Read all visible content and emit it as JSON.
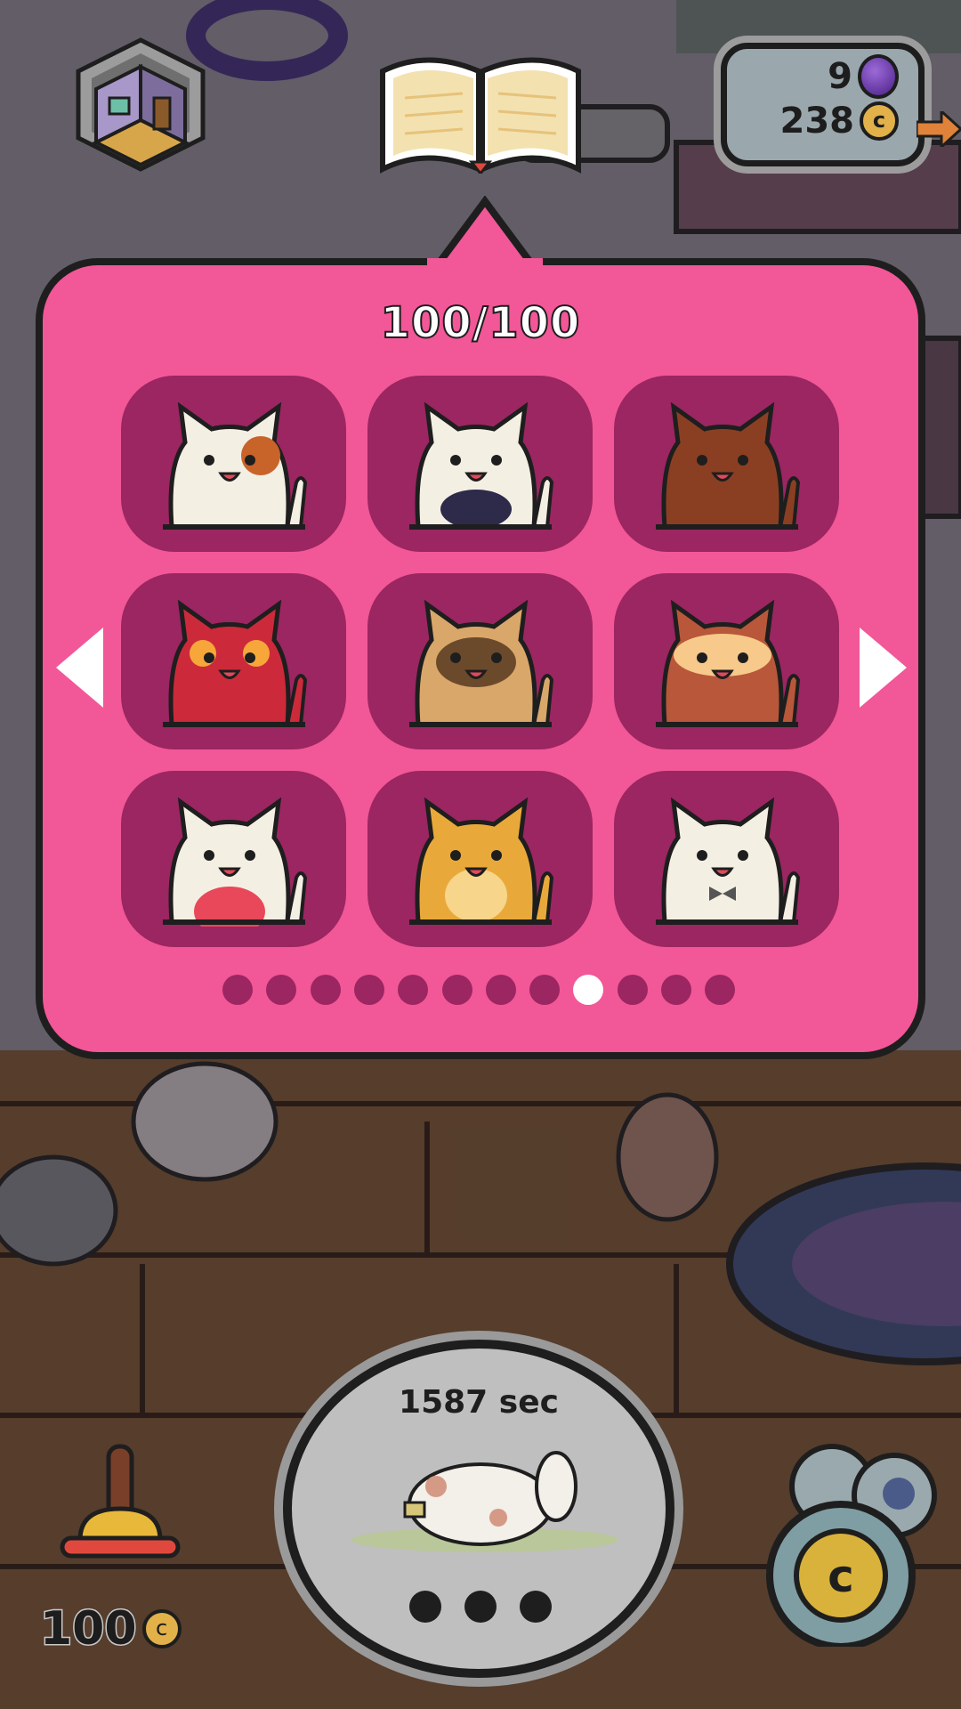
{
  "colors": {
    "panel": "#f25797",
    "slot": "#9b2661",
    "dot_active": "#ffffff",
    "dot_inactive": "#9b2661"
  },
  "top_bar": {
    "room_icon": "room-box-icon",
    "book_icon": "catalog-book-icon",
    "gems": "9",
    "coins": "238",
    "gem_icon": "purple-gem-icon",
    "coin_icon": "coin-icon",
    "coin_symbol": "c"
  },
  "catalog": {
    "counter": "100/100",
    "page_index": 8,
    "page_count": 12,
    "cats": [
      {
        "name": "calico-patch-cat",
        "body": "#f4efe3",
        "accent": "#c8632a",
        "pattern": "eyepatch"
      },
      {
        "name": "galaxy-belly-cat",
        "body": "#f4efe3",
        "accent": "#2d2a4a",
        "pattern": "galaxy"
      },
      {
        "name": "brown-cat",
        "body": "#8b3f22",
        "accent": "#5a2914",
        "pattern": "striped-tail"
      },
      {
        "name": "red-owl-cat",
        "body": "#cc2a3a",
        "accent": "#f7a73a",
        "pattern": "owl"
      },
      {
        "name": "siamese-cat",
        "body": "#d9a76a",
        "accent": "#6b4a2c",
        "pattern": "mask"
      },
      {
        "name": "fluffy-orange-cat",
        "body": "#b8573a",
        "accent": "#f7c98a",
        "pattern": "fluff"
      },
      {
        "name": "strawberry-cat",
        "body": "#f4efe3",
        "accent": "#e8485a",
        "pattern": "belly"
      },
      {
        "name": "golden-cat",
        "body": "#e9a93a",
        "accent": "#f7d58a",
        "pattern": "chest"
      },
      {
        "name": "bowtie-cat",
        "body": "#f4efe3",
        "accent": "#555555",
        "pattern": "bowtie"
      }
    ]
  },
  "bottom_bar": {
    "bell_price": "100",
    "timer_text": "1587 sec",
    "bell_icon": "bell-icon",
    "timer_icon": "grazing-cat-icon",
    "coin_jar_icon": "coin-jar-icon"
  }
}
